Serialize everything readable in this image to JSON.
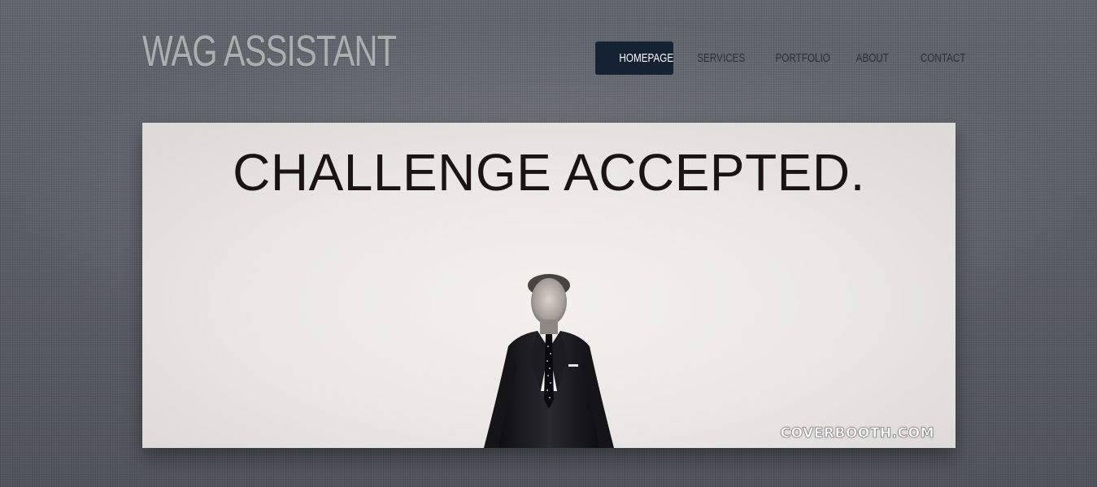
{
  "site": {
    "title": "WAG ASSISTANT"
  },
  "nav": {
    "items": [
      {
        "label": "HOMEPAGE",
        "active": true
      },
      {
        "label": "SERVICES",
        "active": false
      },
      {
        "label": "PORTFOLIO",
        "active": false
      },
      {
        "label": "ABOUT",
        "active": false
      },
      {
        "label": "CONTACT",
        "active": false
      }
    ]
  },
  "banner": {
    "headline": "CHALLENGE ACCEPTED.",
    "watermark": "COVERBOOTH.COM"
  },
  "colors": {
    "background": "#5d6169",
    "title": "#aab0ad",
    "nav_active_bg": "#152234",
    "nav_text": "#2c3038"
  }
}
